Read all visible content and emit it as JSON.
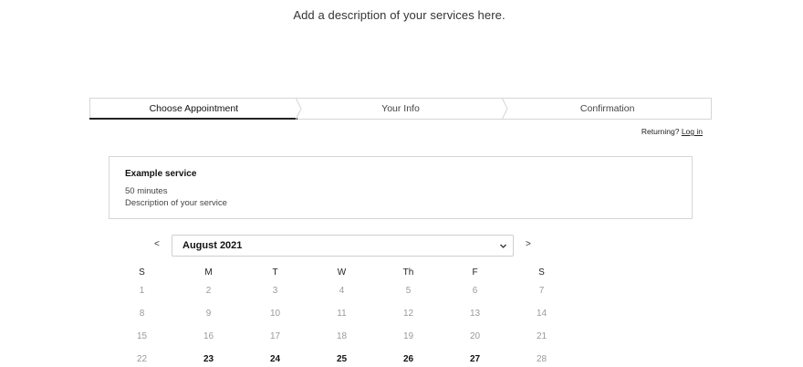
{
  "page": {
    "description": "Add a description of your services here."
  },
  "steps": [
    {
      "label": "Choose Appointment",
      "active": true
    },
    {
      "label": "Your Info",
      "active": false
    },
    {
      "label": "Confirmation",
      "active": false
    }
  ],
  "login": {
    "prompt": "Returning?",
    "link_label": "Log in"
  },
  "service": {
    "name": "Example service",
    "duration": "50 minutes",
    "description": "Description of your service"
  },
  "calendar": {
    "prev_label": "<",
    "next_label": ">",
    "month_selected": "August 2021",
    "weekday_labels": [
      "S",
      "M",
      "T",
      "W",
      "Th",
      "F",
      "S"
    ],
    "weeks": [
      [
        {
          "d": "1",
          "available": false
        },
        {
          "d": "2",
          "available": false
        },
        {
          "d": "3",
          "available": false
        },
        {
          "d": "4",
          "available": false
        },
        {
          "d": "5",
          "available": false
        },
        {
          "d": "6",
          "available": false
        },
        {
          "d": "7",
          "available": false
        }
      ],
      [
        {
          "d": "8",
          "available": false
        },
        {
          "d": "9",
          "available": false
        },
        {
          "d": "10",
          "available": false
        },
        {
          "d": "11",
          "available": false
        },
        {
          "d": "12",
          "available": false
        },
        {
          "d": "13",
          "available": false
        },
        {
          "d": "14",
          "available": false
        }
      ],
      [
        {
          "d": "15",
          "available": false
        },
        {
          "d": "16",
          "available": false
        },
        {
          "d": "17",
          "available": false
        },
        {
          "d": "18",
          "available": false
        },
        {
          "d": "19",
          "available": false
        },
        {
          "d": "20",
          "available": false
        },
        {
          "d": "21",
          "available": false
        }
      ],
      [
        {
          "d": "22",
          "available": false
        },
        {
          "d": "23",
          "available": true
        },
        {
          "d": "24",
          "available": true
        },
        {
          "d": "25",
          "available": true
        },
        {
          "d": "26",
          "available": true
        },
        {
          "d": "27",
          "available": true
        },
        {
          "d": "28",
          "available": false
        }
      ]
    ]
  },
  "colors": {
    "border": "#d6d6d6",
    "active_underline": "#222222",
    "disabled_day": "#9a9a9a"
  },
  "icons": {
    "select_chevron": "chevron-down-icon"
  }
}
